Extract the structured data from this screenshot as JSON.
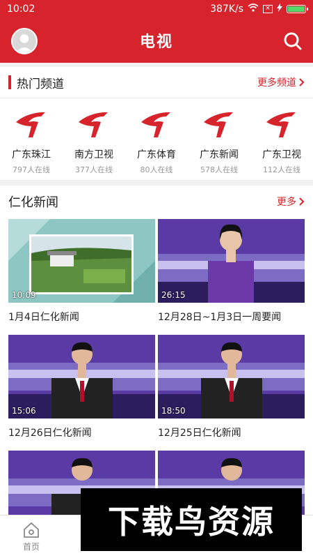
{
  "status": {
    "time": "10:02",
    "speed": "387K/s"
  },
  "header": {
    "title": "电视"
  },
  "hot": {
    "title": "热门频道",
    "more": "更多频道",
    "channels": [
      {
        "name": "广东珠江",
        "count": "797人在线"
      },
      {
        "name": "南方卫视",
        "count": "377人在线"
      },
      {
        "name": "广东体育",
        "count": "80人在线"
      },
      {
        "name": "广东新闻",
        "count": "578人在线"
      },
      {
        "name": "广东卫视",
        "count": "112人在线"
      }
    ]
  },
  "news": {
    "title": "仁化新闻",
    "more": "更多",
    "items": [
      {
        "title": "1月4日仁化新闻",
        "duration": "10:09"
      },
      {
        "title": "12月28日~1月3日一周要闻",
        "duration": "26:15"
      },
      {
        "title": "12月26日仁化新闻",
        "duration": "15:06"
      },
      {
        "title": "12月25日仁化新闻",
        "duration": "18:50"
      },
      {
        "title": "",
        "duration": ""
      },
      {
        "title": "",
        "duration": ""
      }
    ]
  },
  "tabbar": {
    "home": "首页"
  },
  "watermark": {
    "text": "下载鸟资源"
  },
  "colors": {
    "brand": "#d7232b"
  }
}
